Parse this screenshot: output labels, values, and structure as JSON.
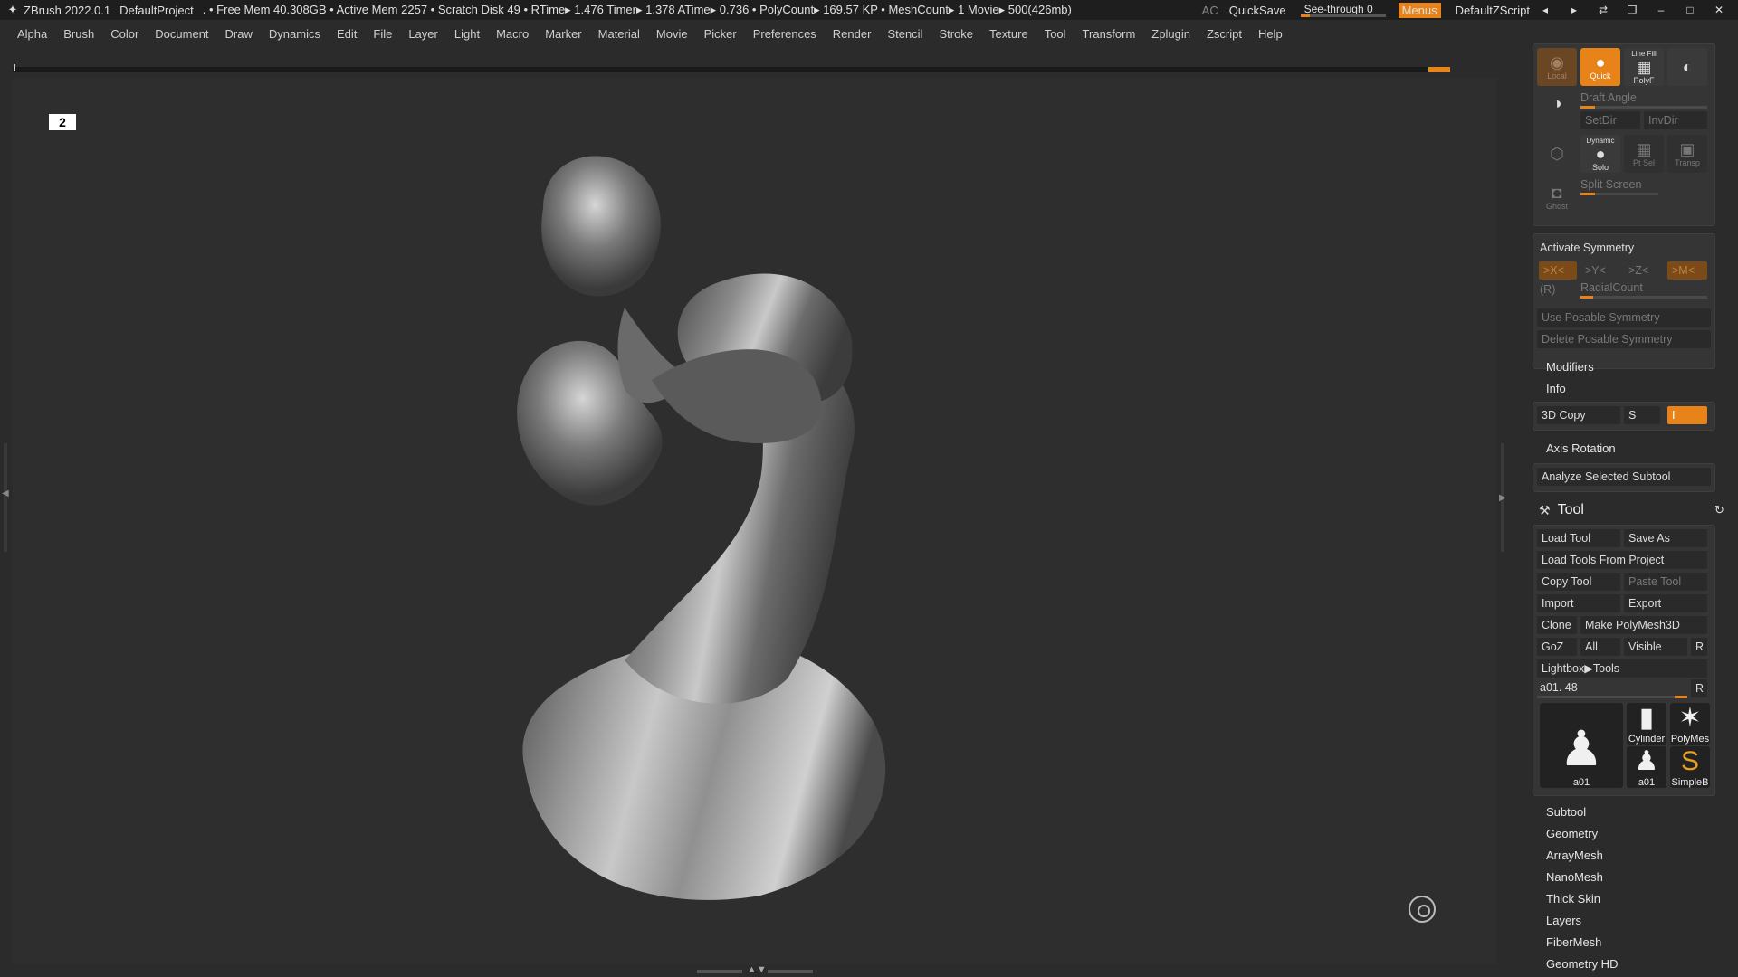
{
  "titlebar": {
    "app": "ZBrush 2022.0.1",
    "project": "DefaultProject",
    "stats": ". • Free Mem 40.308GB • Active Mem 2257 • Scratch Disk 49 •  RTime▸ 1.476 Timer▸ 1.378 ATime▸ 0.736 • PolyCount▸ 169.57 KP  • MeshCount▸ 1  Movie▸ 500(426mb)",
    "ac": "AC",
    "quicksave": "QuickSave",
    "seethrough": "See-through  0",
    "seethrough_value": 0,
    "menus": "Menus",
    "zscript": "DefaultZScript"
  },
  "menu": [
    "Alpha",
    "Brush",
    "Color",
    "Document",
    "Draw",
    "Dynamics",
    "Edit",
    "File",
    "Layer",
    "Light",
    "Macro",
    "Marker",
    "Material",
    "Movie",
    "Picker",
    "Preferences",
    "Render",
    "Stencil",
    "Stroke",
    "Texture",
    "Tool",
    "Transform",
    "Zplugin",
    "Zscript",
    "Help"
  ],
  "canvas": {
    "corner_icon": "2"
  },
  "panel": {
    "top_buttons": {
      "local": "Local",
      "quick": "Quick",
      "linefill": "Line Fill",
      "polyf": "PolyF",
      "draft_angle": "Draft Angle",
      "setdir": "SetDir",
      "invdir": "InvDir",
      "dynamic": "Dynamic",
      "solo": "Solo",
      "ptsel": "Pt Sel",
      "transp": "Transp",
      "split_screen": "Split Screen",
      "ghost": "Ghost"
    },
    "symmetry": {
      "title": "Activate Symmetry",
      "x": ">X<",
      "y": ">Y<",
      "z": ">Z<",
      "m": ">M<",
      "r": "(R)",
      "radial": "RadialCount",
      "posable": "Use Posable Symmetry",
      "delete_posable": "Delete Posable Symmetry"
    },
    "modifiers": "Modifiers",
    "info": "Info",
    "copy3d": {
      "label": "3D Copy",
      "s": "S",
      "i": "I"
    },
    "axis_rotation": "Axis Rotation",
    "analyze": "Analyze Selected Subtool",
    "tool": {
      "title": "Tool",
      "load_tool": "Load Tool",
      "save_as": "Save As",
      "load_from_project": "Load Tools From Project",
      "copy_tool": "Copy Tool",
      "paste_tool": "Paste Tool",
      "import": "Import",
      "export": "Export",
      "clone": "Clone",
      "make_polymesh": "Make PolyMesh3D",
      "goz": "GoZ",
      "all": "All",
      "visible": "Visible",
      "r": "R",
      "lightbox": "Lightbox▶Tools",
      "current": "a01. 48",
      "current_value": 48,
      "thumbs": [
        "a01",
        "Cylinder",
        "PolyMes",
        "a01",
        "SimpleB"
      ]
    },
    "sections": [
      "Subtool",
      "Geometry",
      "ArrayMesh",
      "NanoMesh",
      "Thick Skin",
      "Layers",
      "FiberMesh",
      "Geometry HD"
    ]
  }
}
